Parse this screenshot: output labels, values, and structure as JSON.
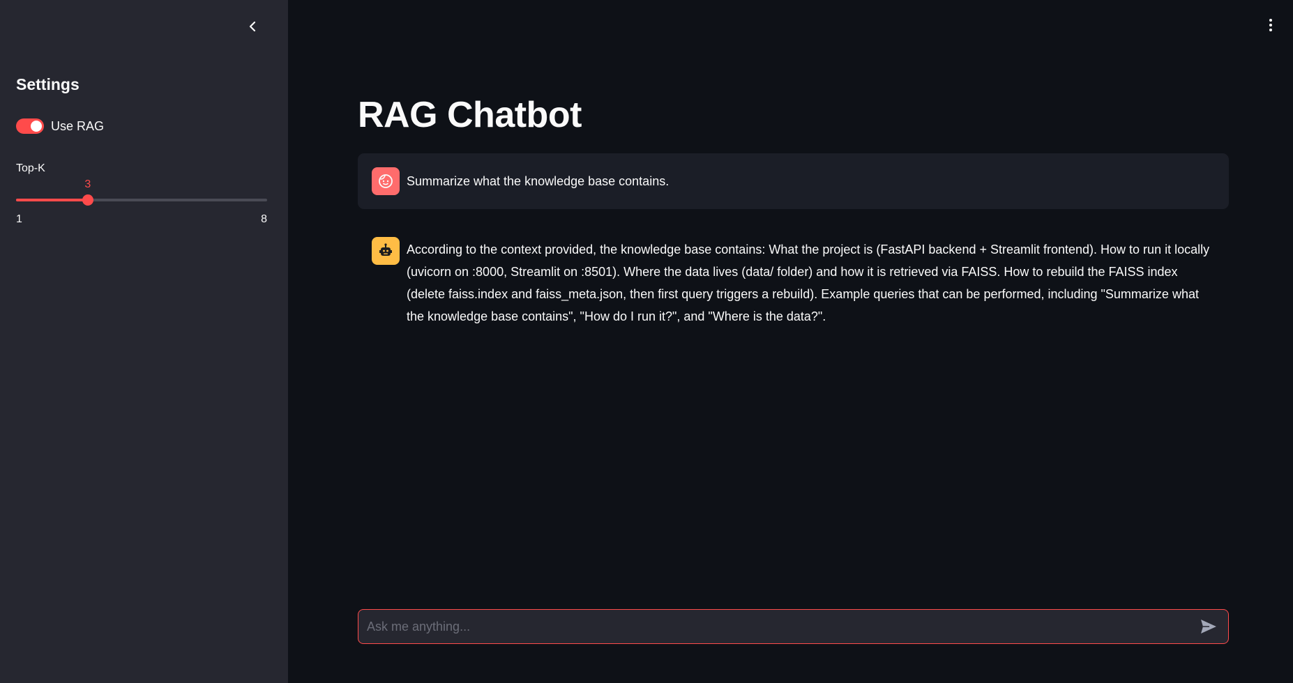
{
  "sidebar": {
    "title": "Settings",
    "use_rag": {
      "label": "Use RAG",
      "enabled": true
    },
    "top_k": {
      "label": "Top-K",
      "value": 3,
      "min": 1,
      "max": 8,
      "min_label": "1",
      "max_label": "8",
      "value_label": "3"
    }
  },
  "main": {
    "title": "RAG Chatbot",
    "messages": [
      {
        "role": "user",
        "avatar_icon": "face-icon",
        "text": "Summarize what the knowledge base contains."
      },
      {
        "role": "assistant",
        "avatar_icon": "robot-icon",
        "text": "According to the context provided, the knowledge base contains: What the project is (FastAPI backend + Streamlit frontend). How to run it locally (uvicorn on :8000, Streamlit on :8501). Where the data lives (data/ folder) and how it is retrieved via FAISS. How to rebuild the FAISS index (delete faiss.index and faiss_meta.json, then first query triggers a rebuild). Example queries that can be performed, including \"Summarize what the knowledge base contains\", \"How do I run it?\", and \"Where is the data?\"."
      }
    ],
    "chat_input": {
      "placeholder": "Ask me anything...",
      "value": ""
    }
  },
  "colors": {
    "accent": "#ff4b4b",
    "background": "#0e1117",
    "sidebar": "#262730",
    "user_avatar": "#ff6c6c",
    "bot_avatar": "#ffbd45"
  }
}
